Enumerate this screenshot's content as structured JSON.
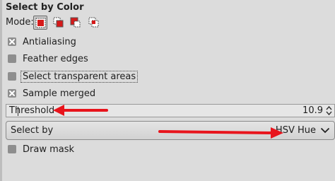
{
  "panel": {
    "title": "Select by Color",
    "mode_label": "Mode:",
    "modes": [
      {
        "name": "replace",
        "active": true
      },
      {
        "name": "add",
        "active": false
      },
      {
        "name": "subtract",
        "active": false
      },
      {
        "name": "intersect",
        "active": false
      }
    ]
  },
  "options": {
    "antialiasing": {
      "label": "Antialiasing",
      "checked": true
    },
    "feather_edges": {
      "label": "Feather edges",
      "checked": false
    },
    "select_transparent": {
      "label": "Select transparent areas",
      "checked": false
    },
    "sample_merged": {
      "label": "Sample merged",
      "checked": true
    },
    "draw_mask": {
      "label": "Draw mask",
      "checked": false
    }
  },
  "threshold": {
    "label": "Threshold",
    "value": "10.9"
  },
  "select_by": {
    "label": "Select by",
    "value": "HSV Hue"
  },
  "colors": {
    "annotation_arrow": "#e8141c",
    "checkbox": "#8e8e8e"
  }
}
